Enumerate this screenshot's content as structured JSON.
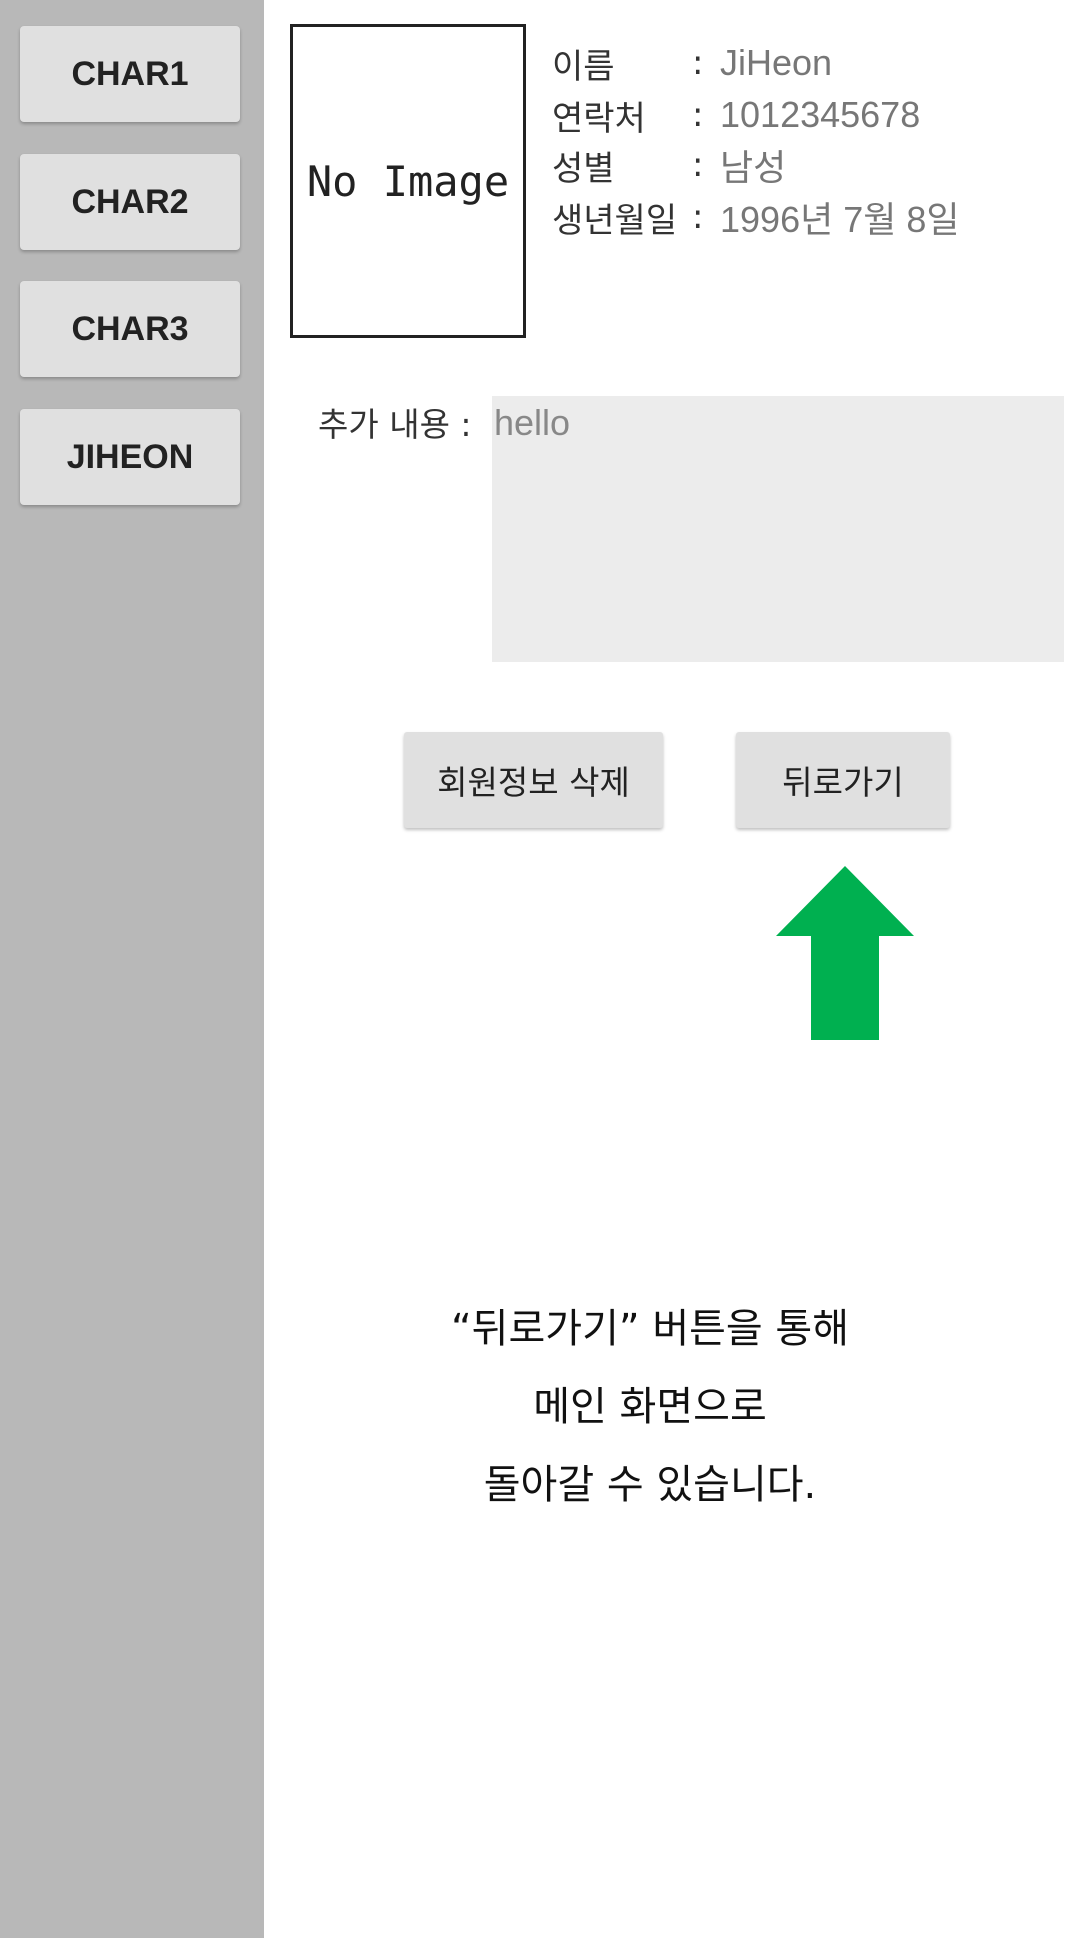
{
  "sidebar": {
    "items": [
      {
        "label": "CHAR1"
      },
      {
        "label": "CHAR2"
      },
      {
        "label": "CHAR3"
      },
      {
        "label": "JIHEON"
      }
    ]
  },
  "profile": {
    "photo_placeholder": "No Image",
    "fields": [
      {
        "label": "이름",
        "colon": ":",
        "value": "JiHeon"
      },
      {
        "label": "연락처",
        "colon": ":",
        "value": "1012345678"
      },
      {
        "label": "성별",
        "colon": ":",
        "value": "남성"
      },
      {
        "label": "생년월일",
        "colon": ":",
        "value": "1996년 7월 8일"
      }
    ],
    "extra_label": "추가 내용 :",
    "extra_value": "hello"
  },
  "actions": {
    "delete_label": "회원정보 삭제",
    "back_label": "뒤로가기"
  },
  "arrow_color": "#00b050",
  "caption": {
    "line1": "“뒤로가기” 버튼을 통해",
    "line2": "메인 화면으로",
    "line3": "돌아갈 수 있습니다."
  }
}
